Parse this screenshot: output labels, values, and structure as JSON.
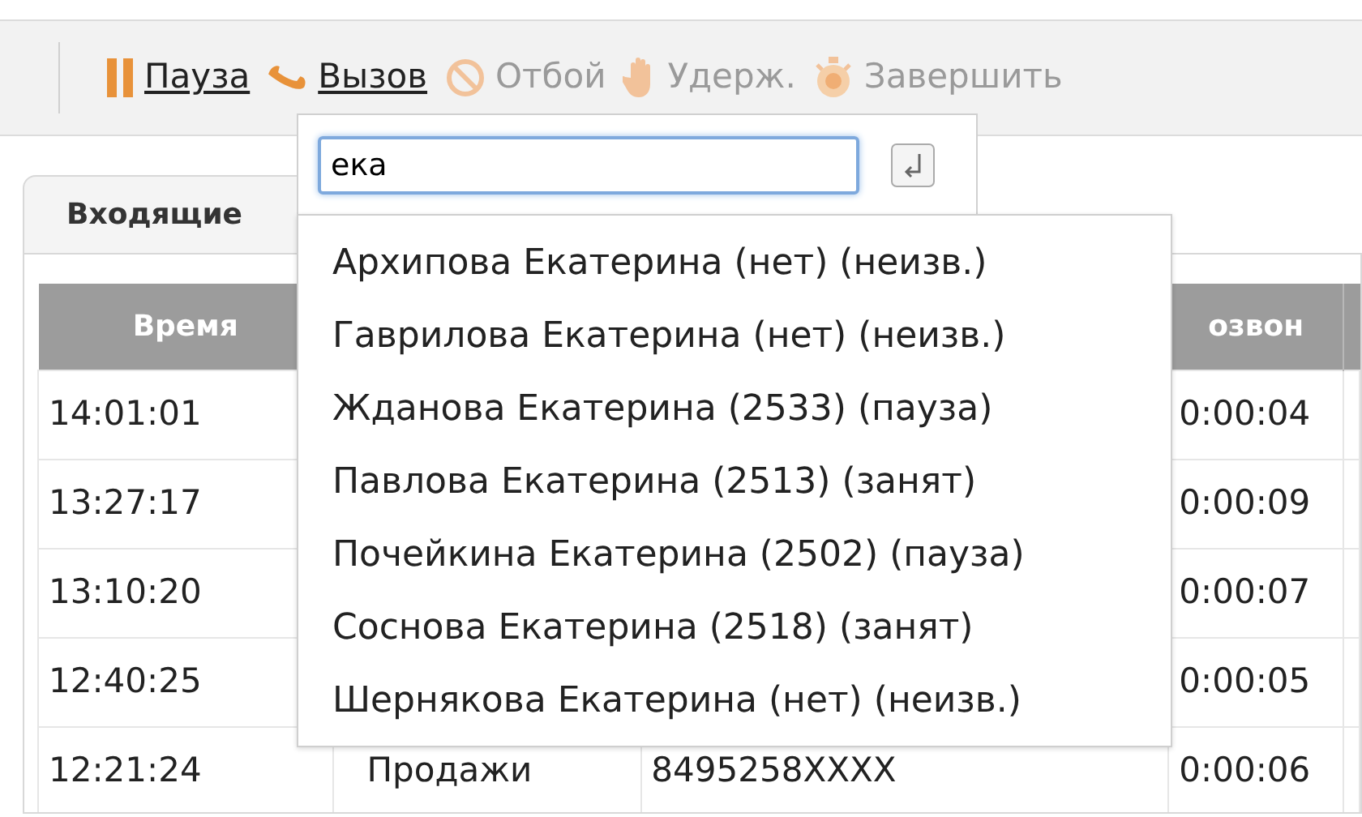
{
  "toolbar": {
    "buttons": [
      {
        "kind": "pause",
        "label": "Пауза",
        "disabled": false
      },
      {
        "kind": "call",
        "label": "Вызов",
        "disabled": false
      },
      {
        "kind": "hangup",
        "label": "Отбой",
        "disabled": true
      },
      {
        "kind": "hold",
        "label": "Удерж.",
        "disabled": true
      },
      {
        "kind": "finish",
        "label": "Завершить",
        "disabled": true
      }
    ]
  },
  "tab": {
    "label": "Входящие"
  },
  "table": {
    "columns": [
      "Время",
      "",
      "",
      "озвон"
    ],
    "rows": [
      {
        "time": "14:01:01",
        "column_4": "0:00:04"
      },
      {
        "time": "13:27:17",
        "column_4": "0:00:09"
      },
      {
        "time": "13:10:20",
        "column_4": "0:00:07"
      },
      {
        "time": "12:40:25",
        "column_4": "0:00:05"
      },
      {
        "time": "12:21:24",
        "column_2": "Продажи",
        "column_3": "8495258XXXX",
        "column_4": "0:00:06"
      }
    ]
  },
  "call_popup": {
    "search": {
      "value": "ека"
    },
    "results": [
      "Архипова Екатерина (нет) (неизв.)",
      "Гаврилова Екатерина (нет) (неизв.)",
      "Жданова Екатерина (2533) (пауза)",
      "Павлова Екатерина (2513) (занят)",
      "Почейкина Екатерина (2502) (пауза)",
      "Соснова Екатерина (2518) (занят)",
      "Шернякова Екатерина (нет) (неизв.)"
    ]
  }
}
